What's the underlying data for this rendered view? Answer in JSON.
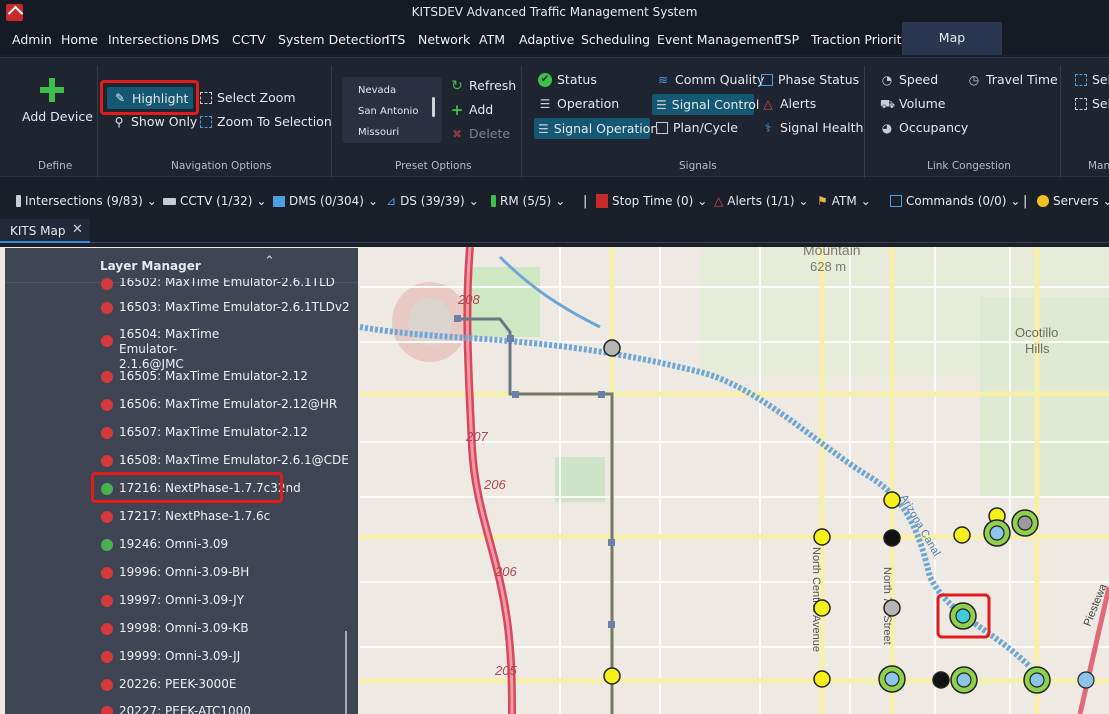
{
  "window": {
    "title": "KITSDEV Advanced Traffic Management System"
  },
  "menu": [
    "Admin",
    "Home",
    "Intersections",
    "DMS",
    "CCTV",
    "System Detection",
    "ITS",
    "Network",
    "ATM",
    "Adaptive",
    "Scheduling",
    "Event Management",
    "TSP",
    "Traction Priority",
    "Map"
  ],
  "ribbon": {
    "define": {
      "label": "Define",
      "add_device": "Add Device"
    },
    "navigation": {
      "label": "Navigation Options",
      "highlight": "Highlight",
      "show_only": "Show Only",
      "select_zoom": "Select Zoom",
      "zoom_to_selection": "Zoom To Selection"
    },
    "preset": {
      "label": "Preset Options",
      "items": [
        "Nevada",
        "San Antonio",
        "Missouri"
      ],
      "refresh": "Refresh",
      "add": "Add",
      "delete": "Delete"
    },
    "signals": {
      "label": "Signals",
      "status": "Status",
      "operation": "Operation",
      "signal_operation": "Signal Operation",
      "comm_quality": "Comm Quality",
      "signal_control": "Signal Control",
      "plan_cycle": "Plan/Cycle",
      "phase_status": "Phase Status",
      "alerts": "Alerts",
      "signal_health": "Signal Health"
    },
    "link": {
      "label": "Link Congestion",
      "speed": "Speed",
      "volume": "Volume",
      "occupancy": "Occupancy",
      "travel_time": "Travel Time"
    },
    "more": {
      "label": "Man",
      "sel1": "Sel",
      "sel2": "Sel"
    }
  },
  "toolbar": {
    "intersections": "Intersections (9/83)",
    "cctv": "CCTV (1/32)",
    "dms": "DMS (0/304)",
    "ds": "DS (39/39)",
    "rm": "RM (5/5)",
    "stop_time": "Stop Time (0)",
    "alerts": "Alerts (1/1)",
    "atm": "ATM",
    "commands": "Commands (0/0)",
    "servers": "Servers"
  },
  "tabs": {
    "map_tab": "KITS Map"
  },
  "layer_manager": {
    "title": "Layer Manager",
    "items": [
      {
        "label": "16502: MaxTime Emulator-2.6.1TLD",
        "status": "red"
      },
      {
        "label": "16503: MaxTime Emulator-2.6.1TLDv2",
        "status": "red"
      },
      {
        "label": "16504: MaxTime Emulator-2.1.6@JMC",
        "status": "red"
      },
      {
        "label": "16505: MaxTime Emulator-2.12",
        "status": "red"
      },
      {
        "label": "16506: MaxTime Emulator-2.12@HR",
        "status": "red"
      },
      {
        "label": "16507: MaxTime Emulator-2.12",
        "status": "red"
      },
      {
        "label": "16508: MaxTime Emulator-2.6.1@CDE",
        "status": "red"
      },
      {
        "label": "17216: NextPhase-1.7.7c32nd",
        "status": "green"
      },
      {
        "label": "17217: NextPhase-1.7.6c",
        "status": "red"
      },
      {
        "label": "19246: Omni-3.09",
        "status": "green"
      },
      {
        "label": "19996: Omni-3.09-BH",
        "status": "red"
      },
      {
        "label": "19997: Omni-3.09-JY",
        "status": "red"
      },
      {
        "label": "19998: Omni-3.09-KB",
        "status": "red"
      },
      {
        "label": "19999: Omni-3.09-JJ",
        "status": "red"
      },
      {
        "label": "20226: PEEK-3000E",
        "status": "red"
      },
      {
        "label": "20227: PEEK-ATC1000",
        "status": "red"
      }
    ]
  },
  "map": {
    "labels": {
      "mountain": "Mountain",
      "elevation": "628 m",
      "hills1": "Ocotillo",
      "hills2": "Hills",
      "hwy208": "208",
      "hwy207": "207",
      "hwy206a": "206",
      "hwy206b": "206",
      "hwy205": "205",
      "street1": "North Central Avenue",
      "street2": "North 7th Street",
      "street3": "Arizona Canal",
      "street4": "Piestewa"
    }
  },
  "colors": {
    "accent": "#155873",
    "highlight_red": "#e01c1c",
    "status_red": "#d53a3a",
    "status_green": "#4caf50",
    "marker_yellow": "#f5ef1a",
    "marker_ring_green": "#8fd14f",
    "marker_blue": "#8cc4ea",
    "marker_cyan": "#40c9d8"
  }
}
